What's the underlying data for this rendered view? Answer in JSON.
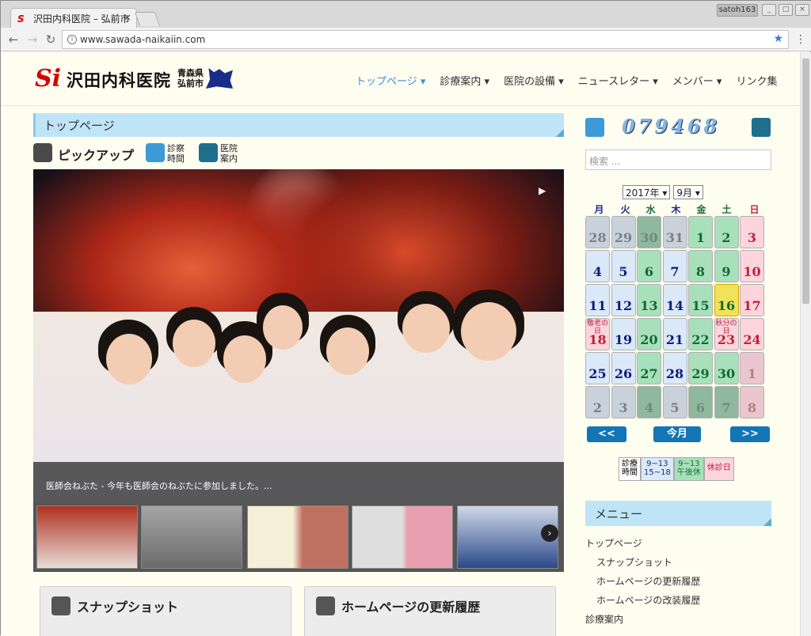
{
  "browser": {
    "tab_title": "沢田内科医院 – 弘前市",
    "tab_close": "×",
    "user": "satoh163",
    "url": "www.sawada-naikaiin.com"
  },
  "site": {
    "logo_mark": "Si",
    "logo_name": "沢田内科医院",
    "logo_sub1": "青森県",
    "logo_sub2": "弘前市",
    "nav": [
      "トップページ ▾",
      "診療案内 ▾",
      "医院の設備 ▾",
      "ニュースレター ▾",
      "メンバー ▾",
      "リンク集"
    ]
  },
  "main": {
    "section_title": "トップページ",
    "pickup_label": "ピックアップ",
    "link1_l1": "診察",
    "link1_l2": "時間",
    "link2_l1": "医院",
    "link2_l2": "案内",
    "caption": "医師会ねぶた - 今年も医師会のねぶたに参加しました。...",
    "box1_title": "スナップショット",
    "box2_title": "ホームページの更新履歴"
  },
  "sidebar": {
    "counter": "079468",
    "search_placeholder": "検索 ...",
    "year": "2017年 ▾",
    "month": "9月 ▾",
    "dow": [
      "月",
      "火",
      "水",
      "木",
      "金",
      "土",
      "日"
    ],
    "weeks": [
      [
        "28",
        "29",
        "30",
        "31",
        "1",
        "2",
        "3"
      ],
      [
        "4",
        "5",
        "6",
        "7",
        "8",
        "9",
        "10"
      ],
      [
        "11",
        "12",
        "13",
        "14",
        "15",
        "16",
        "17"
      ],
      [
        "18",
        "19",
        "20",
        "21",
        "22",
        "23",
        "24"
      ],
      [
        "25",
        "26",
        "27",
        "28",
        "29",
        "30",
        "1"
      ],
      [
        "2",
        "3",
        "4",
        "5",
        "6",
        "7",
        "8"
      ]
    ],
    "holiday_18": "敬老の日",
    "holiday_23": "秋分の日",
    "prev": "<<",
    "today": "今月",
    "next": ">>",
    "legend": {
      "l0a": "診療",
      "l0b": "時間",
      "l1a": "9~13",
      "l1b": "15~18",
      "l2a": "9~13",
      "l2b": "午後休",
      "l3": "休診日"
    },
    "menu_title": "メニュー",
    "menu": [
      "トップページ",
      "スナップショット",
      "ホームページの更新履歴",
      "ホームページの改装履歴",
      "診療案内"
    ]
  }
}
